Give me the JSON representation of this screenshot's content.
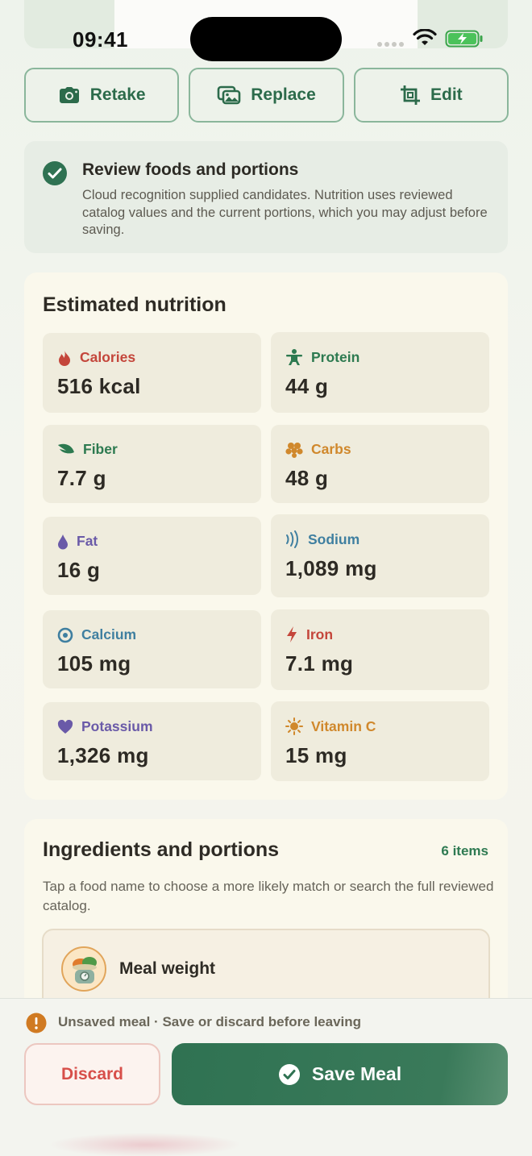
{
  "status_bar": {
    "time": "09:41"
  },
  "actions": {
    "retake": "Retake",
    "replace": "Replace",
    "edit": "Edit"
  },
  "review": {
    "title": "Review foods and portions",
    "text": "Cloud recognition supplied candidates. Nutrition uses reviewed catalog values and the current portions, which you may adjust before saving."
  },
  "nutrition": {
    "title": "Estimated nutrition",
    "items": [
      {
        "label": "Calories",
        "value": "516 kcal",
        "icon": "flame-icon",
        "color": "#c4463b"
      },
      {
        "label": "Protein",
        "value": "44 g",
        "icon": "figure-strength-icon",
        "color": "#2d7a50"
      },
      {
        "label": "Fiber",
        "value": "7.7 g",
        "icon": "leaf-icon",
        "color": "#2d7a50"
      },
      {
        "label": "Carbs",
        "value": "48 g",
        "icon": "grain-cluster-icon",
        "color": "#d0882c"
      },
      {
        "label": "Fat",
        "value": "16 g",
        "icon": "drop-icon",
        "color": "#6a5aa8"
      },
      {
        "label": "Sodium",
        "value": "1,089 mg",
        "icon": "waves-icon",
        "color": "#3f7fa0"
      },
      {
        "label": "Calcium",
        "value": "105 mg",
        "icon": "circle-dot-icon",
        "color": "#3f7fa0"
      },
      {
        "label": "Iron",
        "value": "7.1 mg",
        "icon": "bolt-icon",
        "color": "#c4463b"
      },
      {
        "label": "Potassium",
        "value": "1,326 mg",
        "icon": "heart-icon",
        "color": "#6a5aa8"
      },
      {
        "label": "Vitamin C",
        "value": "15 mg",
        "icon": "sun-icon",
        "color": "#d0882c"
      }
    ]
  },
  "ingredients": {
    "title": "Ingredients and portions",
    "count": "6 items",
    "hint": "Tap a food name to choose a more likely match or search the full reviewed catalog.",
    "meal_weight_label": "Meal weight"
  },
  "bottom": {
    "warning": "Unsaved meal · Save or discard before leaving",
    "discard": "Discard",
    "save": "Save Meal"
  },
  "colors": {
    "accent": "#2f7252",
    "danger": "#d74f4a",
    "warning": "#d07a22"
  }
}
